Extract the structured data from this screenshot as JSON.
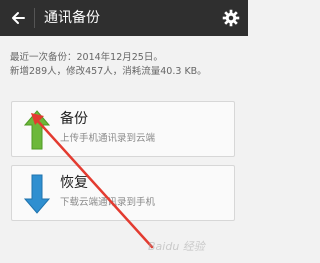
{
  "header": {
    "title": "通讯备份",
    "back_icon": "arrow-left-icon",
    "settings_icon": "gear-icon",
    "background": "#2f2f2f"
  },
  "info": {
    "last_backup": "最近一次备份：2014年12月25日。",
    "stats": "新增289人，修改457人，消耗流量40.3 KB。"
  },
  "actions": [
    {
      "title": "备份",
      "subtitle": "上传手机通讯录到云端",
      "icon": "upload-arrow-icon",
      "icon_color": "#6cb83a"
    },
    {
      "title": "恢复",
      "subtitle": "下载云端通讯录到手机",
      "icon": "download-arrow-icon",
      "icon_color": "#2f8fd0"
    }
  ],
  "annotation_color": "#e33b30",
  "watermark": "Baidu 经验"
}
